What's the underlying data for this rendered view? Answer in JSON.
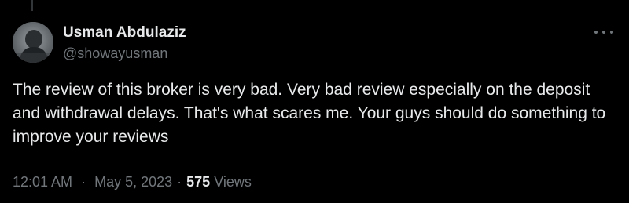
{
  "tweet": {
    "author": {
      "display_name": "Usman Abdulaziz",
      "handle": "@showayusman"
    },
    "text": "The review of this broker is very bad. Very bad review especially on the deposit and withdrawal delays. That's what scares me. Your guys should do something to improve your reviews",
    "time": "12:01 AM",
    "separator": "·",
    "date": "May 5, 2023",
    "views_count": "575",
    "views_label": "Views"
  },
  "icons": {
    "more": "more-horizontal-icon",
    "avatar": "user-avatar"
  },
  "colors": {
    "background": "#000000",
    "primary_text": "#e7e9ea",
    "secondary_text": "#71767b"
  }
}
